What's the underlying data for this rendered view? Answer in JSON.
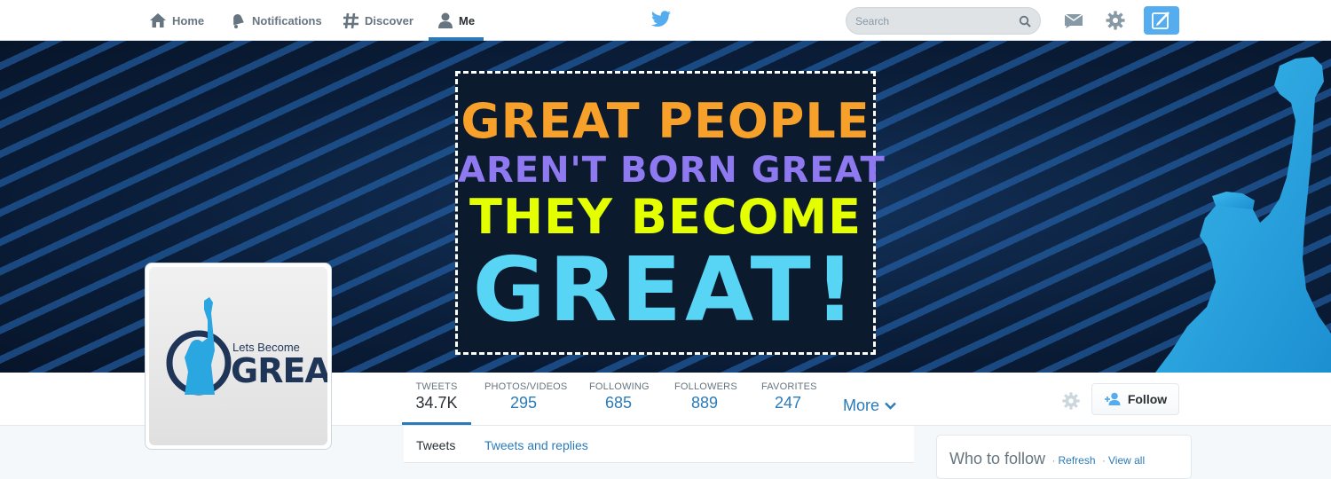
{
  "nav": {
    "items": [
      {
        "label": "Home",
        "icon": "home-icon"
      },
      {
        "label": "Notifications",
        "icon": "bell-icon"
      },
      {
        "label": "Discover",
        "icon": "hashtag-icon"
      },
      {
        "label": "Me",
        "icon": "person-icon"
      }
    ],
    "active": "Me",
    "search_placeholder": "Search",
    "logo_icon": "twitter-bird-icon",
    "right_icons": [
      "messages-icon",
      "gear-icon",
      "compose-tweet-icon"
    ]
  },
  "banner": {
    "quote_lines": [
      "GREAT PEOPLE",
      "AREN'T BORN GREAT",
      "THEY BECOME",
      "GREAT!"
    ],
    "colors": {
      "line1": "#f7a12b",
      "line2": "#8f79f0",
      "line3": "#e3ff00",
      "line4": "#58d4f5"
    }
  },
  "avatar": {
    "logo_small": "Lets Become",
    "logo_big": "GREAT"
  },
  "stats": [
    {
      "label": "TWEETS",
      "value": "34.7K"
    },
    {
      "label": "PHOTOS/VIDEOS",
      "value": "295"
    },
    {
      "label": "FOLLOWING",
      "value": "685"
    },
    {
      "label": "FOLLOWERS",
      "value": "889"
    },
    {
      "label": "FAVORITES",
      "value": "247"
    }
  ],
  "more_label": "More",
  "follow_label": "Follow",
  "tabs": [
    "Tweets",
    "Tweets and replies"
  ],
  "who_to_follow": {
    "title": "Who to follow",
    "refresh": "Refresh",
    "view_all": "View all"
  },
  "theme": {
    "accent": "#2b7bb9",
    "twitter_blue": "#55acee"
  }
}
